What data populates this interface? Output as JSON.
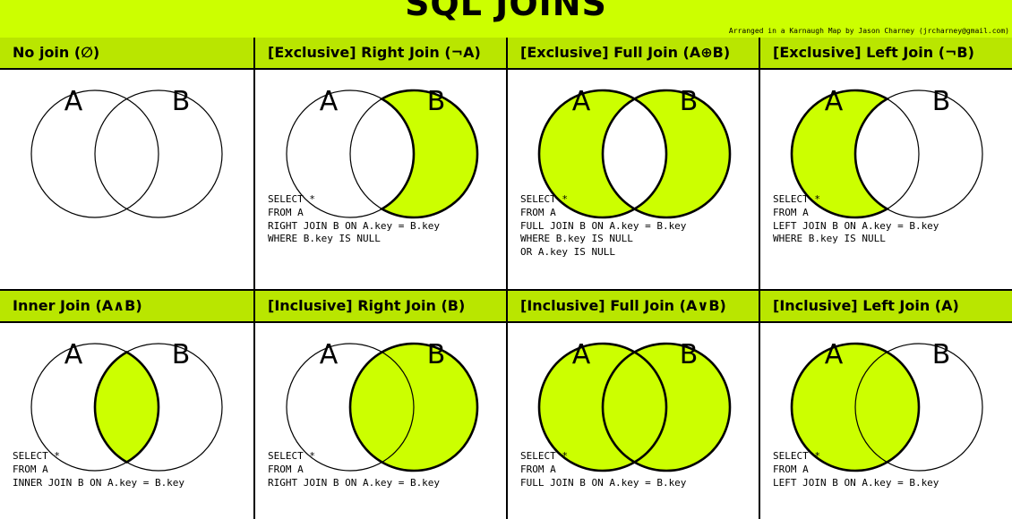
{
  "header": {
    "title": "SQL JOINS",
    "credit": "Arranged in a Karnaugh Map by Jason Charney (jrcharney@gmail.com)"
  },
  "colors": {
    "fill": "#ccff00",
    "header": "#b9e600"
  },
  "labels": {
    "a": "A",
    "b": "B"
  },
  "panels": [
    {
      "title": "No join (∅)",
      "fill": "none",
      "code": []
    },
    {
      "title": "[Exclusive] Right Join (¬A)",
      "fill": "b-only",
      "code": [
        "SELECT *",
        "FROM A",
        "RIGHT JOIN B ON A.key = B.key",
        "WHERE B.key IS NULL"
      ]
    },
    {
      "title": "[Exclusive] Full Join (A⊕B)",
      "fill": "xor",
      "code": [
        "SELECT *",
        "FROM A",
        "FULL JOIN B ON A.key = B.key",
        "WHERE B.key IS NULL",
        "OR A.key IS NULL"
      ]
    },
    {
      "title": "[Exclusive] Left Join (¬B)",
      "fill": "a-only",
      "code": [
        "SELECT *",
        "FROM A",
        "LEFT JOIN B ON A.key = B.key",
        "WHERE B.key IS NULL"
      ]
    },
    {
      "title": "Inner Join (A∧B)",
      "fill": "intersection",
      "code": [
        "SELECT *",
        "FROM A",
        "INNER JOIN B ON A.key = B.key"
      ]
    },
    {
      "title": "[Inclusive] Right Join (B)",
      "fill": "b",
      "code": [
        "SELECT *",
        "FROM A",
        "RIGHT JOIN B ON A.key = B.key"
      ]
    },
    {
      "title": "[Inclusive] Full Join (A∨B)",
      "fill": "union",
      "code": [
        "SELECT *",
        "FROM A",
        "FULL JOIN B ON A.key = B.key"
      ]
    },
    {
      "title": "[Inclusive] Left Join (A)",
      "fill": "a",
      "code": [
        "SELECT *",
        "FROM A",
        "LEFT JOIN B ON A.key = B.key"
      ]
    }
  ]
}
